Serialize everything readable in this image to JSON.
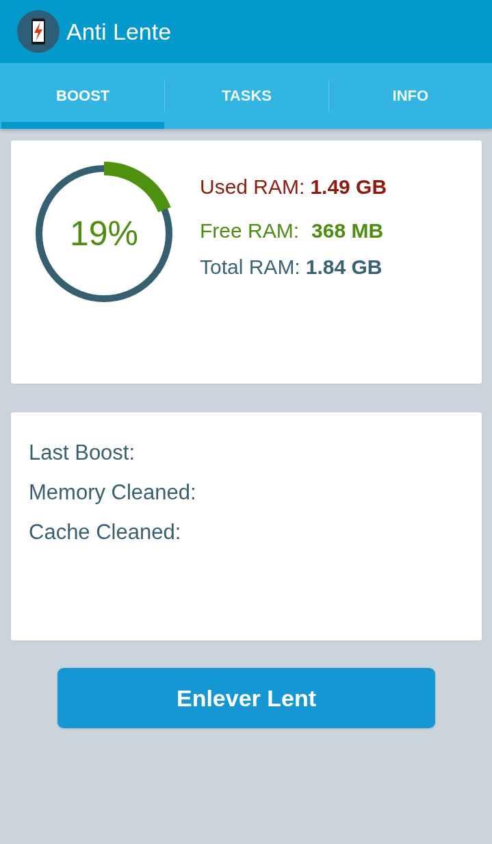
{
  "app_bar": {
    "title": "Anti Lente"
  },
  "tabs": [
    {
      "label": "BOOST",
      "selected": true
    },
    {
      "label": "TASKS",
      "selected": false
    },
    {
      "label": "INFO",
      "selected": false
    }
  ],
  "memory": {
    "gauge": {
      "level": 0.19,
      "reading": "19%"
    },
    "stats": [
      {
        "label": "Used RAM:",
        "value": "1.49 GB",
        "color": "#8e1b0e"
      },
      {
        "label": "Free RAM:",
        "value": "368 MB",
        "color": "#4e8c12"
      },
      {
        "label": "Total RAM:",
        "value": "1.84 GB",
        "color": "#3a6273"
      }
    ]
  },
  "boost_info": {
    "lines": [
      "Last Boost:",
      "Memory Cleaned:",
      "Cache Cleaned:"
    ]
  },
  "action_button": {
    "label": "Enlever Lent"
  }
}
